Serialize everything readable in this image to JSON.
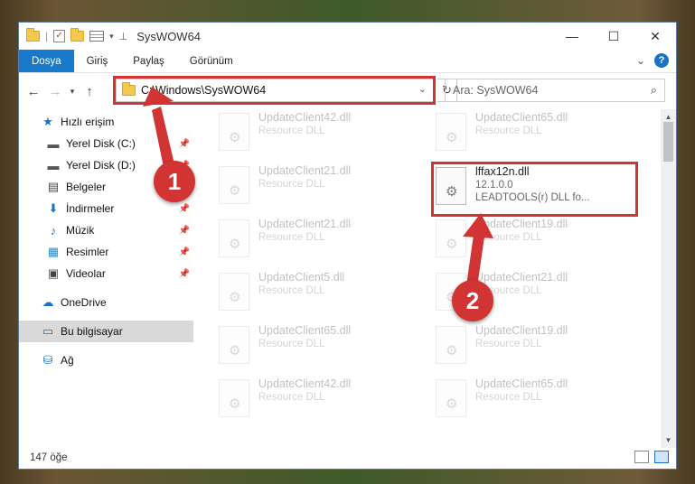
{
  "window": {
    "title": "SysWOW64",
    "controls": {
      "minimize": "—",
      "maximize": "☐",
      "close": "✕"
    }
  },
  "ribbon": {
    "tabs": [
      "Dosya",
      "Giriş",
      "Paylaş",
      "Görünüm"
    ],
    "expand_glyph": "⌄",
    "help": "?"
  },
  "address": {
    "path": "C:\\Windows\\SysWOW64",
    "search_placeholder": "Ara: SysWOW64"
  },
  "sidebar": {
    "items": [
      {
        "label": "Hızlı erişim",
        "icon": "star-icon",
        "glyph": "★",
        "color": "#1a73c4",
        "pinned": false
      },
      {
        "label": "Yerel Disk (C:)",
        "icon": "drive-icon",
        "glyph": "▬",
        "color": "#555555",
        "pinned": true
      },
      {
        "label": "Yerel Disk (D:)",
        "icon": "drive-icon",
        "glyph": "▬",
        "color": "#555555",
        "pinned": true
      },
      {
        "label": "Belgeler",
        "icon": "document-icon",
        "glyph": "▤",
        "color": "#444444",
        "pinned": true
      },
      {
        "label": "İndirmeler",
        "icon": "download-icon",
        "glyph": "⬇",
        "color": "#1a73c4",
        "pinned": true
      },
      {
        "label": "Müzik",
        "icon": "music-icon",
        "glyph": "♪",
        "color": "#1a73c4",
        "pinned": true
      },
      {
        "label": "Resimler",
        "icon": "pictures-icon",
        "glyph": "▦",
        "color": "#2e8bc0",
        "pinned": true
      },
      {
        "label": "Videolar",
        "icon": "video-icon",
        "glyph": "▣",
        "color": "#444444",
        "pinned": true
      },
      {
        "label": "OneDrive",
        "icon": "cloud-icon",
        "glyph": "☁",
        "color": "#1a73c4",
        "pinned": false
      },
      {
        "label": "Bu bilgisayar",
        "icon": "computer-icon",
        "glyph": "▭",
        "color": "#1a73c4",
        "pinned": false,
        "selected": true
      },
      {
        "label": "Ağ",
        "icon": "network-icon",
        "glyph": "⛁",
        "color": "#1a73c4",
        "pinned": false
      }
    ]
  },
  "files": {
    "left": [
      {
        "name": "UpdateClient42.dll",
        "sub": "Resource DLL"
      },
      {
        "name": "UpdateClient21.dll",
        "sub": "Resource DLL"
      },
      {
        "name": "UpdateClient21.dll",
        "sub": "Resource DLL"
      },
      {
        "name": "UpdateClient5.dll",
        "sub": "Resource DLL"
      },
      {
        "name": "UpdateClient65.dll",
        "sub": "Resource DLL"
      },
      {
        "name": "UpdateClient42.dll",
        "sub": "Resource DLL"
      }
    ],
    "right": [
      {
        "name": "UpdateClient65.dll",
        "sub": "Resource DLL"
      },
      {
        "name": "lffax12n.dll",
        "sub": "12.1.0.0",
        "sub2": "LEADTOOLS(r) DLL fo...",
        "highlight": true
      },
      {
        "name": "UpdateClient19.dll",
        "sub": "Resource DLL"
      },
      {
        "name": "UpdateClient21.dll",
        "sub": "Resource DLL"
      },
      {
        "name": "UpdateClient19.dll",
        "sub": "Resource DLL"
      },
      {
        "name": "UpdateClient65.dll",
        "sub": "Resource DLL"
      }
    ]
  },
  "status": {
    "count": "147 öğe"
  },
  "annotations": {
    "badge1": "1",
    "badge2": "2",
    "color": "#d23333"
  }
}
